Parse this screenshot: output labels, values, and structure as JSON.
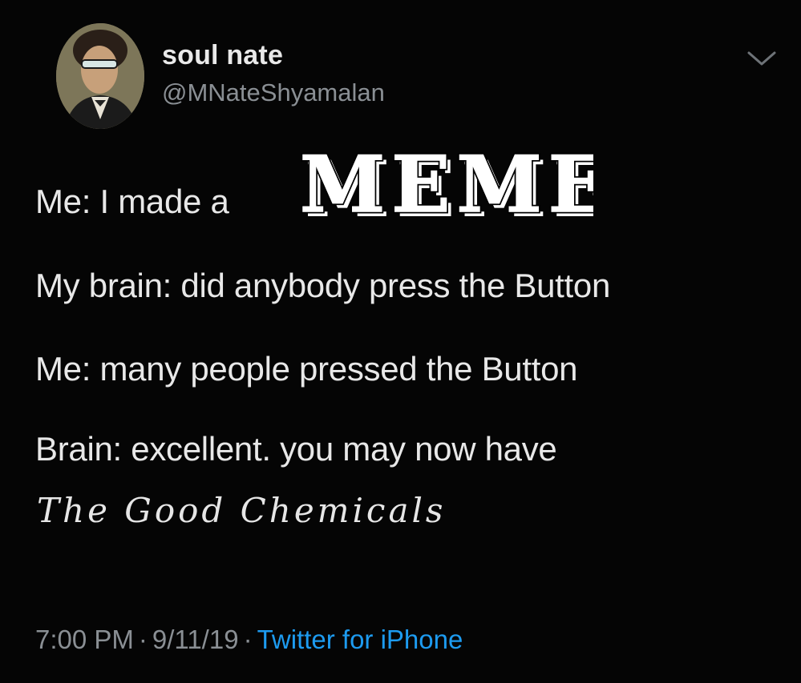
{
  "user": {
    "display_name": "soul nate",
    "handle": "@MNateShyamalan"
  },
  "tweet": {
    "line1_prefix": "Me: I made a",
    "meme_word": "MEME",
    "line2": "My brain: did anybody press the Button",
    "line3": "Me: many people pressed the Button",
    "line4": "Brain: excellent. you may now have",
    "line5": "The Good Chemicals"
  },
  "meta": {
    "time": "7:00 PM",
    "sep1": "·",
    "date": "9/11/19",
    "sep2": "·",
    "source": "Twitter for iPhone"
  },
  "icons": {
    "menu": "chevron-down-icon",
    "avatar": "avatar"
  },
  "colors": {
    "background": "#050505",
    "text": "#e8e8e8",
    "secondary": "#8a8f94",
    "link": "#1d9bf0"
  }
}
